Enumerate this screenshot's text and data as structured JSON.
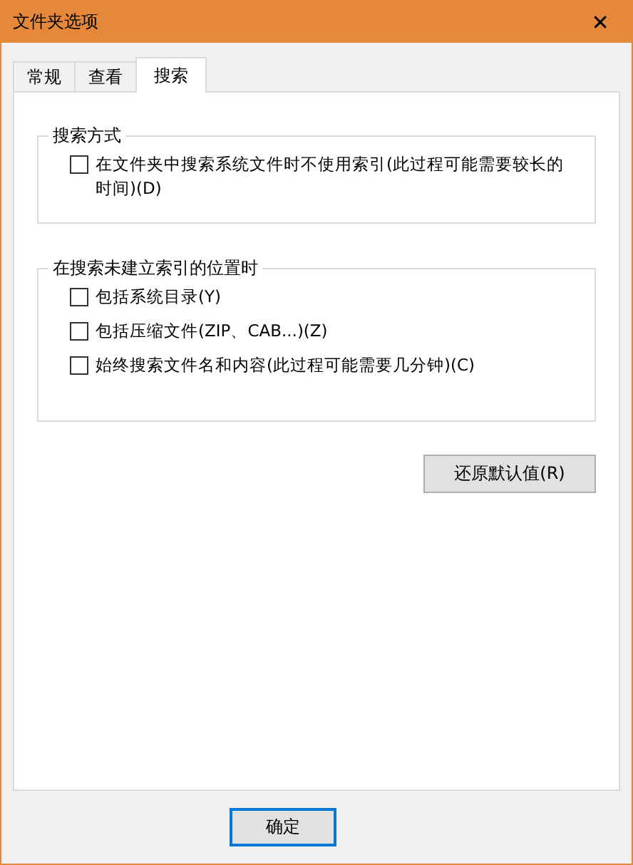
{
  "window": {
    "title": "文件夹选项",
    "close": "✕"
  },
  "tabs": [
    {
      "label": "常规",
      "selected": false
    },
    {
      "label": "查看",
      "selected": false
    },
    {
      "label": "搜索",
      "selected": true
    }
  ],
  "groups": [
    {
      "title": "搜索方式",
      "options": [
        {
          "label": "在文件夹中搜索系统文件时不使用索引(此过程可能需要较长的时间)(D)",
          "checked": false
        }
      ]
    },
    {
      "title": "在搜索未建立索引的位置时",
      "options": [
        {
          "label": "包括系统目录(Y)",
          "checked": false
        },
        {
          "label": "包括压缩文件(ZIP、CAB...)(Z)",
          "checked": false
        },
        {
          "label": "始终搜索文件名和内容(此过程可能需要几分钟)(C)",
          "checked": false
        }
      ]
    }
  ],
  "restore_button": "还原默认值(R)",
  "footer_buttons": [
    {
      "label": "确定",
      "default": true
    }
  ]
}
